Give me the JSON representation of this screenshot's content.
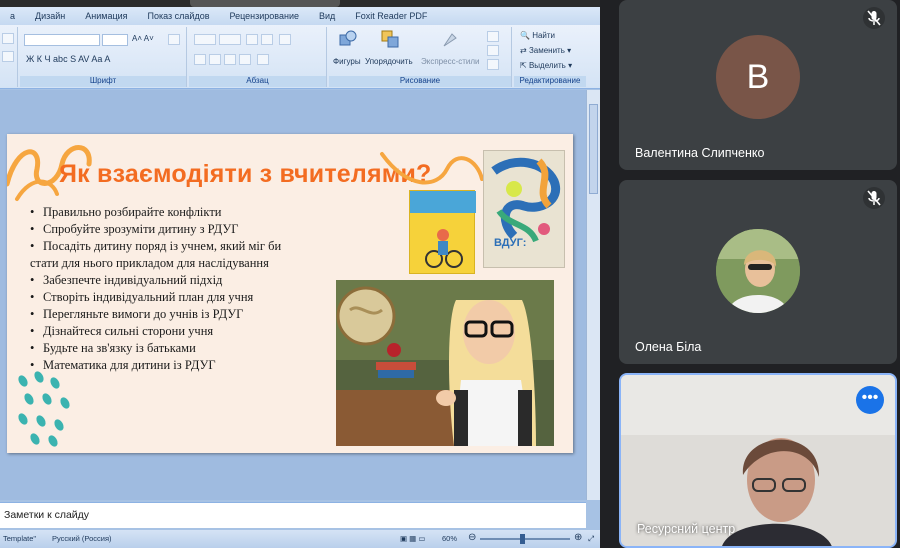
{
  "ribbon": {
    "tabs": [
      "а",
      "Дизайн",
      "Анимация",
      "Показ слайдов",
      "Рецензирование",
      "Вид",
      "Foxit Reader PDF"
    ],
    "groups": {
      "font": "Шрифт",
      "paragraph": "Абзац",
      "drawing": "Рисование",
      "editing": "Редактирование"
    },
    "drawing_buttons": {
      "shapes": "Фигуры",
      "arrange": "Упорядочить",
      "quick_styles": "Экспресс-стили"
    },
    "editing_buttons": {
      "find": "Найти",
      "replace": "Заменить",
      "select": "Выделить"
    }
  },
  "slide": {
    "title": "Як взаємодіяти з вчителями?",
    "bullets": [
      "Правильно розбирайте конфлікти",
      "Спробуйте зрозуміти дитину з РДУГ",
      "Посадіть  дитину поряд із учнем, який міг би",
      "стати для нього прикладом для наслідування",
      "Забезпечте індивідуальний підхід",
      "Створіть індивідуальний  план для учня",
      "Перегляньте вимоги до учнів із РДУГ",
      "Дізнайтеся  сильні сторони учня",
      "Будьте на зв'язку із батьками",
      "Математика для дитини із РДУГ"
    ],
    "book_title": "ВДУГ:"
  },
  "notes": {
    "placeholder": "Заметки к слайду"
  },
  "statusbar": {
    "template": "Template\"",
    "language": "Русский (Россия)",
    "zoom": "60%"
  },
  "participants": [
    {
      "name": "Валентина Слипченко",
      "initial": "B",
      "avatar_color": "#795548",
      "muted": true
    },
    {
      "name": "Олена Біла",
      "muted": true
    },
    {
      "name": "Ресурсний центр",
      "active": true
    }
  ],
  "colors": {
    "title_orange": "#f36c21",
    "meet_tile": "#3c4043",
    "meet_accent": "#1a73e8"
  }
}
